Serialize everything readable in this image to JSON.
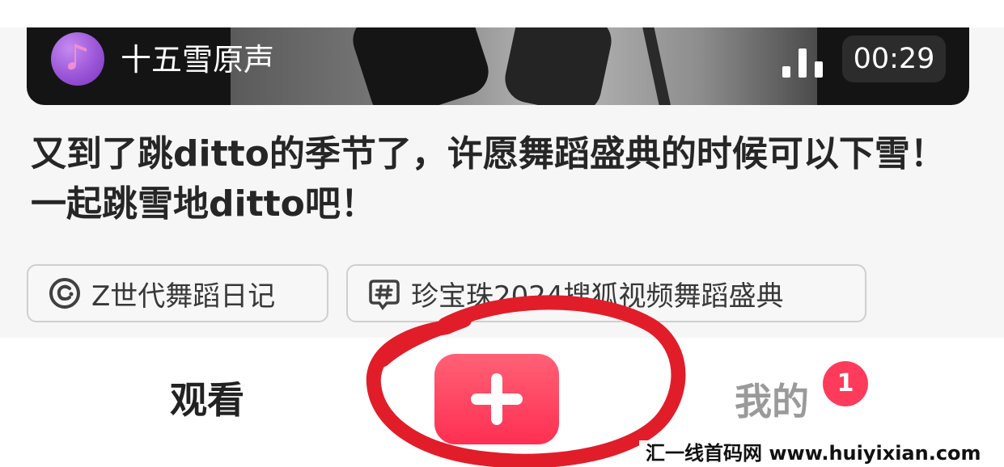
{
  "video": {
    "sound_title": "十五雪原声",
    "duration": "00:29"
  },
  "post": {
    "title": "又到了跳ditto的季节了，许愿舞蹈盛典的时候可以下雪！一起跳雪地ditto吧！"
  },
  "tags": [
    {
      "label": "Z世代舞蹈日记",
      "icon": "circle-c-icon"
    },
    {
      "label": "珍宝珠2024搜狐视频舞蹈盛典",
      "icon": "hash-icon"
    }
  ],
  "tabbar": {
    "watch_label": "观看",
    "mine_label": "我的",
    "notification_count": "1",
    "create_icon": "plus-icon"
  },
  "watermark": {
    "text": "汇一线首码网 www.huiyixian.com"
  },
  "colors": {
    "accent": "#ff3b5c",
    "annotation": "#e21d2a",
    "avatar": "#9a55d8"
  }
}
